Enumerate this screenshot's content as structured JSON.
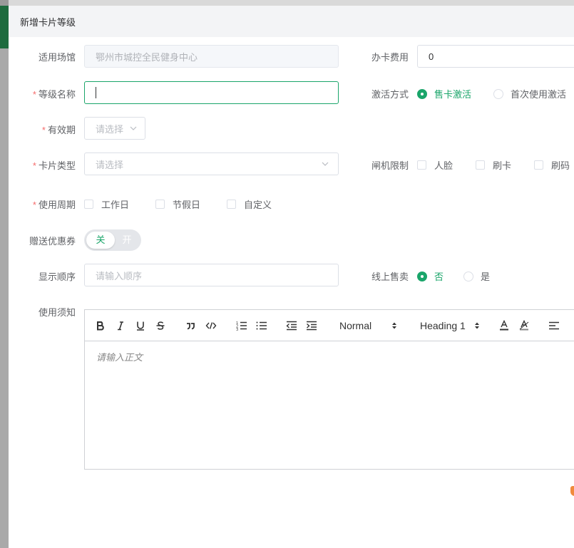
{
  "dialog": {
    "title": "新增卡片等级"
  },
  "fields": {
    "venue": {
      "label": "适用场馆",
      "value": "鄂州市城控全民健身中心",
      "required": false
    },
    "fee": {
      "label": "办卡费用",
      "value": "0"
    },
    "level_name": {
      "label": "等级名称",
      "required": true,
      "value": ""
    },
    "activation": {
      "label": "激活方式",
      "options": [
        "售卡激活",
        "首次使用激活"
      ],
      "selected": "售卡激活"
    },
    "validity": {
      "label": "有效期",
      "required": true,
      "placeholder": "请选择"
    },
    "card_type": {
      "label": "卡片类型",
      "required": true,
      "placeholder": "请选择"
    },
    "gate_limit": {
      "label": "闸机限制",
      "options": [
        "人脸",
        "刷卡",
        "刷码"
      ]
    },
    "usage_period": {
      "label": "使用周期",
      "required": true,
      "options": [
        "工作日",
        "节假日",
        "自定义"
      ]
    },
    "coupon": {
      "label": "赠送优惠券",
      "off_label": "关",
      "on_label": "开",
      "enabled": false
    },
    "display_order": {
      "label": "显示顺序",
      "placeholder": "请输入顺序"
    },
    "online_sale": {
      "label": "线上售卖",
      "options": [
        "否",
        "是"
      ],
      "selected": "否"
    },
    "notice": {
      "label": "使用须知",
      "placeholder": "请输入正文"
    }
  },
  "editor": {
    "format_select": "Normal",
    "heading_select": "Heading 1",
    "tools": [
      "bold-icon",
      "italic-icon",
      "underline-icon",
      "strike-icon",
      "blockquote-icon",
      "code-icon",
      "ordered-list-icon",
      "bullet-list-icon",
      "outdent-icon",
      "indent-icon",
      "text-color-icon",
      "clear-format-icon",
      "align-left-icon"
    ]
  },
  "colors": {
    "accent": "#1aa56a",
    "required": "#f56c6c",
    "header_bg": "#f3f4f6"
  }
}
